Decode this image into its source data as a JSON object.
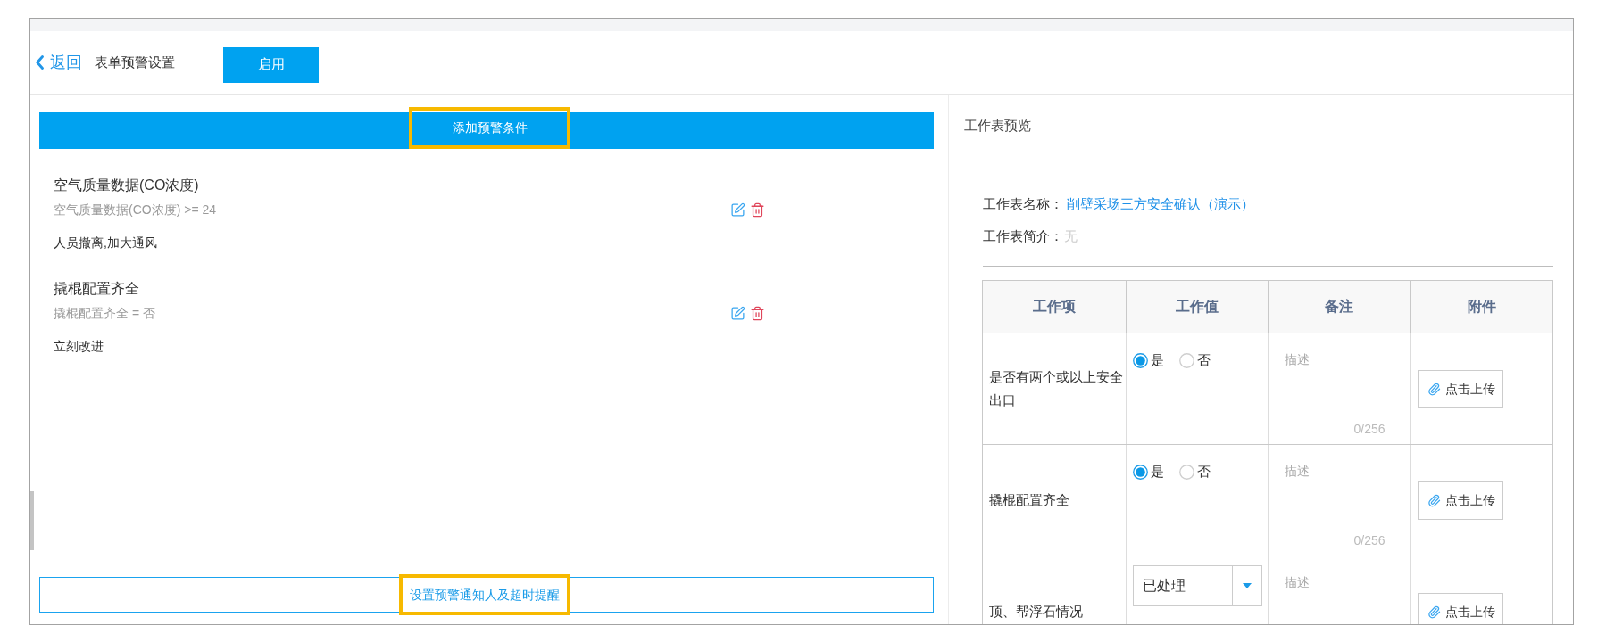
{
  "header": {
    "back_link": "返回",
    "title": "表单预警设置",
    "enable_button": "启用"
  },
  "conditions_panel": {
    "add_button": {
      "label": "添加预警条件",
      "highlighted": true
    },
    "conditions": [
      {
        "title": "空气质量数据(CO浓度)",
        "rule": "空气质量数据(CO浓度) >= 24",
        "action": "人员撤离,加大通风"
      },
      {
        "title": "撬棍配置齐全",
        "rule": "撬棍配置齐全 = 否",
        "action": "立刻改进"
      }
    ],
    "notify_button": {
      "label": "设置预警通知人及超时提醒",
      "highlighted": true
    }
  },
  "preview": {
    "heading": "工作表预览",
    "fields": [
      {
        "label": "工作表名称：",
        "value": "削壁采场三方安全确认（演示）",
        "kind": "link"
      },
      {
        "label": "工作表简介：",
        "value": "无",
        "kind": "empty"
      }
    ],
    "table": {
      "columns": [
        "工作项",
        "工作值",
        "备注",
        "附件"
      ],
      "rows": [
        {
          "item": "是否有两个或以上安全出口",
          "value": {
            "kind": "radio",
            "options": [
              {
                "label": "是",
                "selected": true
              },
              {
                "label": "否",
                "selected": false
              }
            ]
          },
          "remark": {
            "placeholder": "描述",
            "counter": "0/256"
          },
          "attachment": "点击上传"
        },
        {
          "item": "撬棍配置齐全",
          "value": {
            "kind": "radio",
            "options": [
              {
                "label": "是",
                "selected": true
              },
              {
                "label": "否",
                "selected": false
              }
            ]
          },
          "remark": {
            "placeholder": "描述",
            "counter": "0/256"
          },
          "attachment": "点击上传"
        },
        {
          "item": "顶、帮浮石情况",
          "value": {
            "kind": "select",
            "value": "已处理"
          },
          "remark": {
            "placeholder": "描述"
          },
          "attachment": "点击上传"
        }
      ]
    }
  }
}
